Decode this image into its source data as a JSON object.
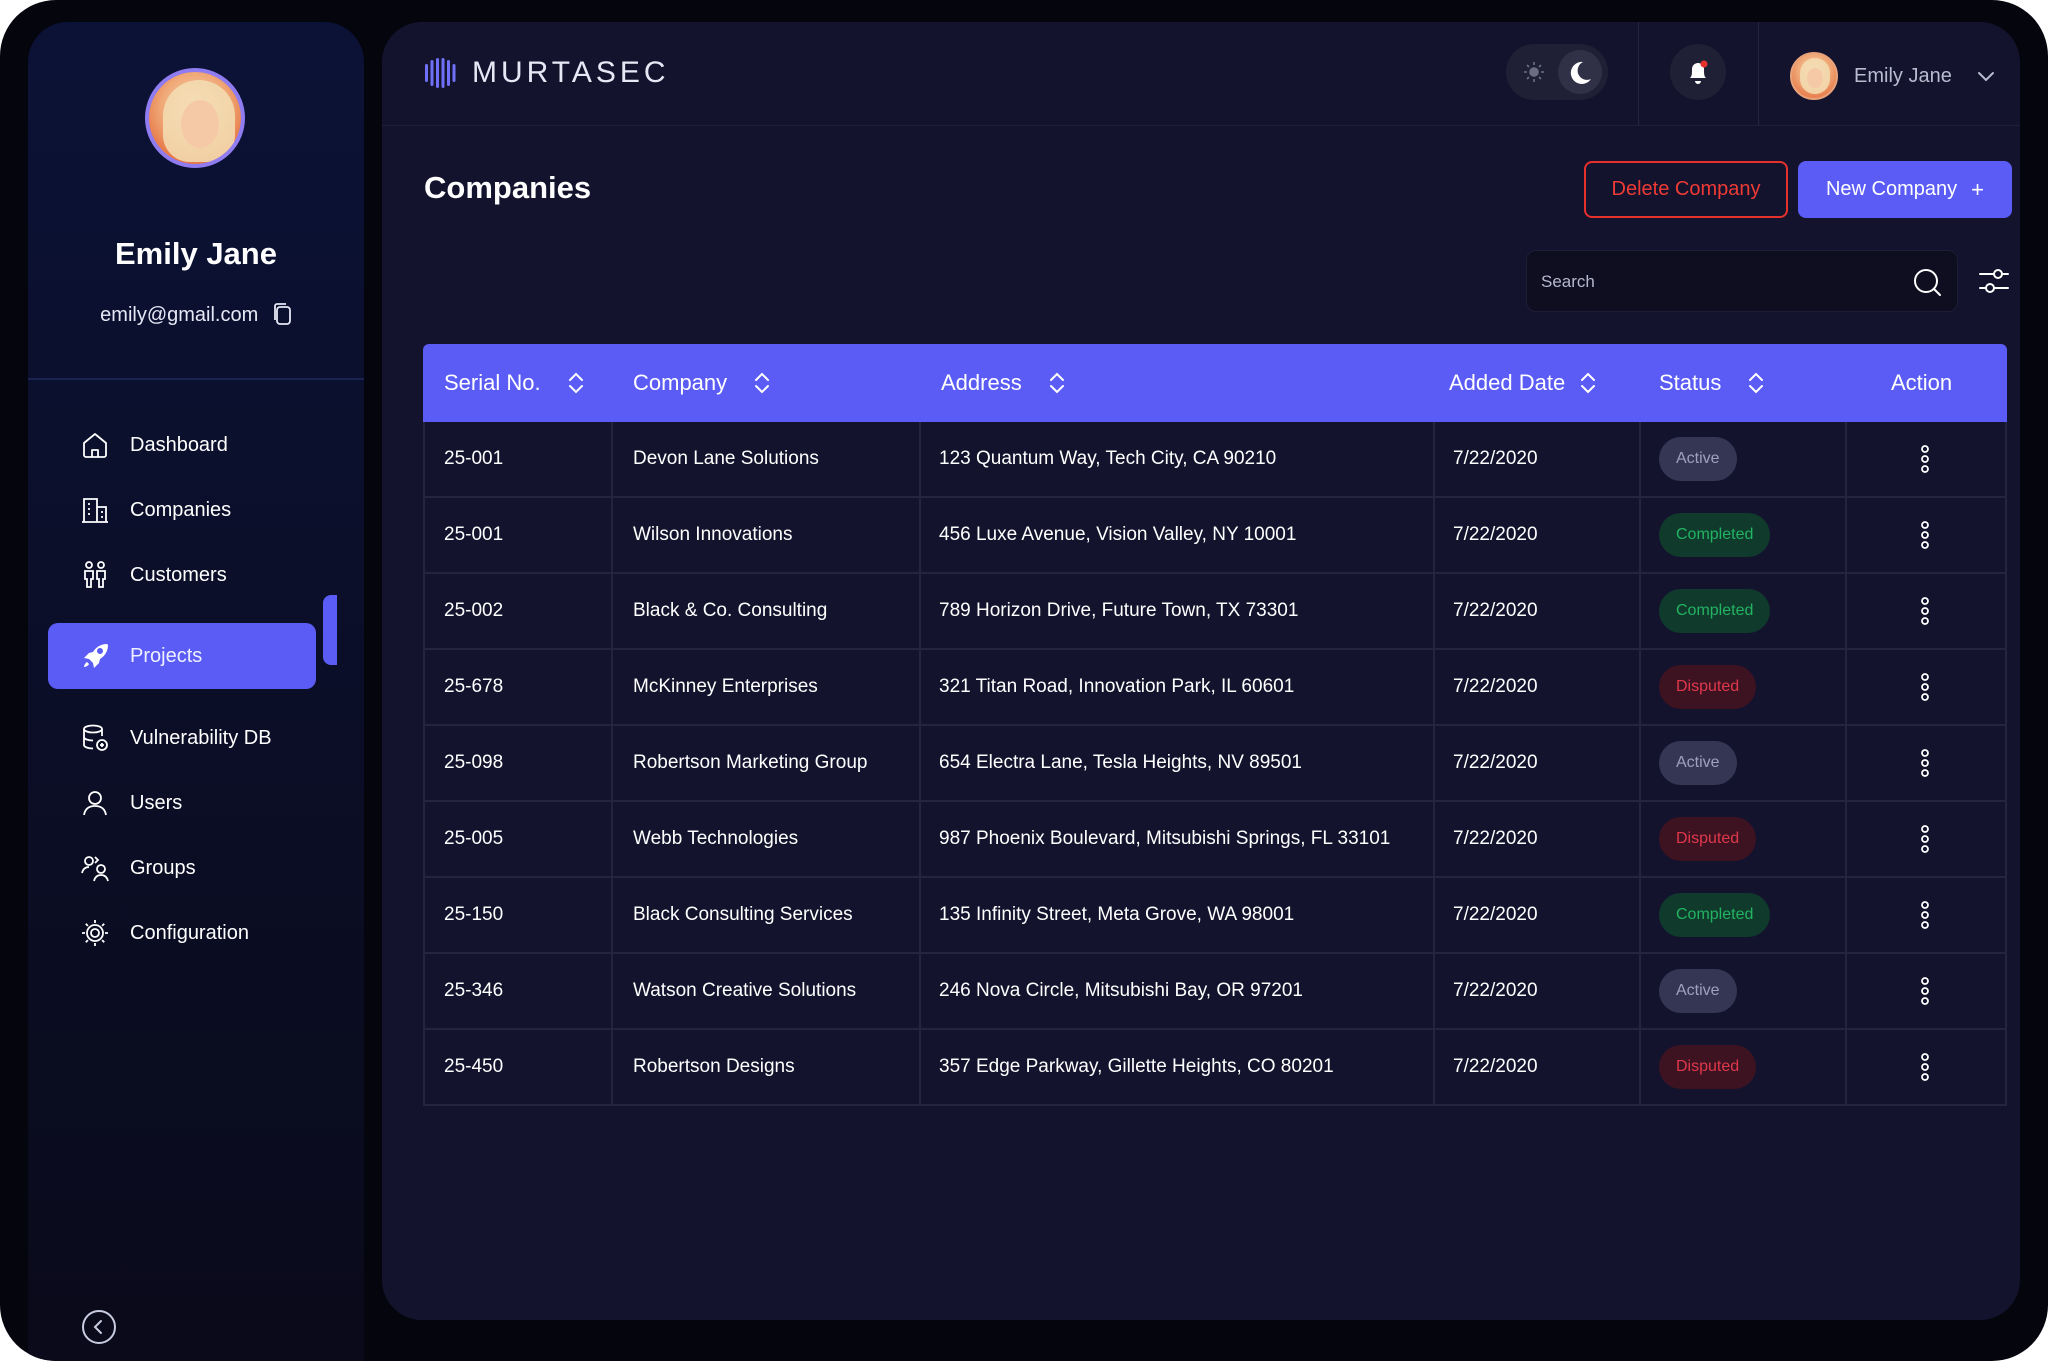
{
  "profile": {
    "name": "Emily Jane",
    "email": "emily@gmail.com"
  },
  "nav": {
    "items": [
      {
        "label": "Dashboard",
        "icon": "home-icon"
      },
      {
        "label": "Companies",
        "icon": "building-icon"
      },
      {
        "label": "Customers",
        "icon": "people-icon"
      },
      {
        "label": "Projects",
        "icon": "rocket-icon",
        "active": true
      },
      {
        "label": "Vulnerability DB",
        "icon": "database-icon"
      },
      {
        "label": "Users",
        "icon": "user-icon"
      },
      {
        "label": "Groups",
        "icon": "group-icon"
      },
      {
        "label": "Configuration",
        "icon": "gear-icon"
      }
    ]
  },
  "header": {
    "brand": "MURTASEC",
    "user_name": "Emily Jane"
  },
  "page": {
    "title": "Companies",
    "delete_label": "Delete Company",
    "new_label": "New Company",
    "search_placeholder": "Search"
  },
  "table": {
    "columns": [
      "Serial No.",
      "Company",
      "Address",
      "Added Date",
      "Status",
      "Action"
    ],
    "rows": [
      {
        "serial": "25-001",
        "company": "Devon Lane Solutions",
        "address": "123 Quantum Way, Tech City, CA 90210",
        "date": "7/22/2020",
        "status": "Active"
      },
      {
        "serial": "25-001",
        "company": "Wilson Innovations",
        "address": "456 Luxe Avenue, Vision Valley, NY 10001",
        "date": "7/22/2020",
        "status": "Completed"
      },
      {
        "serial": "25-002",
        "company": "Black & Co. Consulting",
        "address": "789 Horizon Drive, Future Town, TX 73301",
        "date": "7/22/2020",
        "status": "Completed"
      },
      {
        "serial": "25-678",
        "company": "McKinney Enterprises",
        "address": "321 Titan Road, Innovation Park, IL 60601",
        "date": "7/22/2020",
        "status": "Disputed"
      },
      {
        "serial": "25-098",
        "company": "Robertson Marketing Group",
        "address": "654 Electra Lane, Tesla Heights, NV 89501",
        "date": "7/22/2020",
        "status": "Active"
      },
      {
        "serial": "25-005",
        "company": "Webb Technologies",
        "address": "987 Phoenix Boulevard, Mitsubishi Springs, FL 33101",
        "date": "7/22/2020",
        "status": "Disputed"
      },
      {
        "serial": "25-150",
        "company": "Black Consulting Services",
        "address": "135 Infinity Street, Meta Grove, WA 98001",
        "date": "7/22/2020",
        "status": "Completed"
      },
      {
        "serial": "25-346",
        "company": "Watson Creative Solutions",
        "address": "246 Nova Circle, Mitsubishi Bay, OR 97201",
        "date": "7/22/2020",
        "status": "Active"
      },
      {
        "serial": "25-450",
        "company": "Robertson Designs",
        "address": "357 Edge Parkway, Gillette Heights, CO 80201",
        "date": "7/22/2020",
        "status": "Disputed"
      }
    ]
  },
  "colors": {
    "accent": "#5b5cf5",
    "danger": "#e5302c",
    "panel": "#13132d",
    "completed": "#23b463",
    "disputed": "#e0384b"
  }
}
